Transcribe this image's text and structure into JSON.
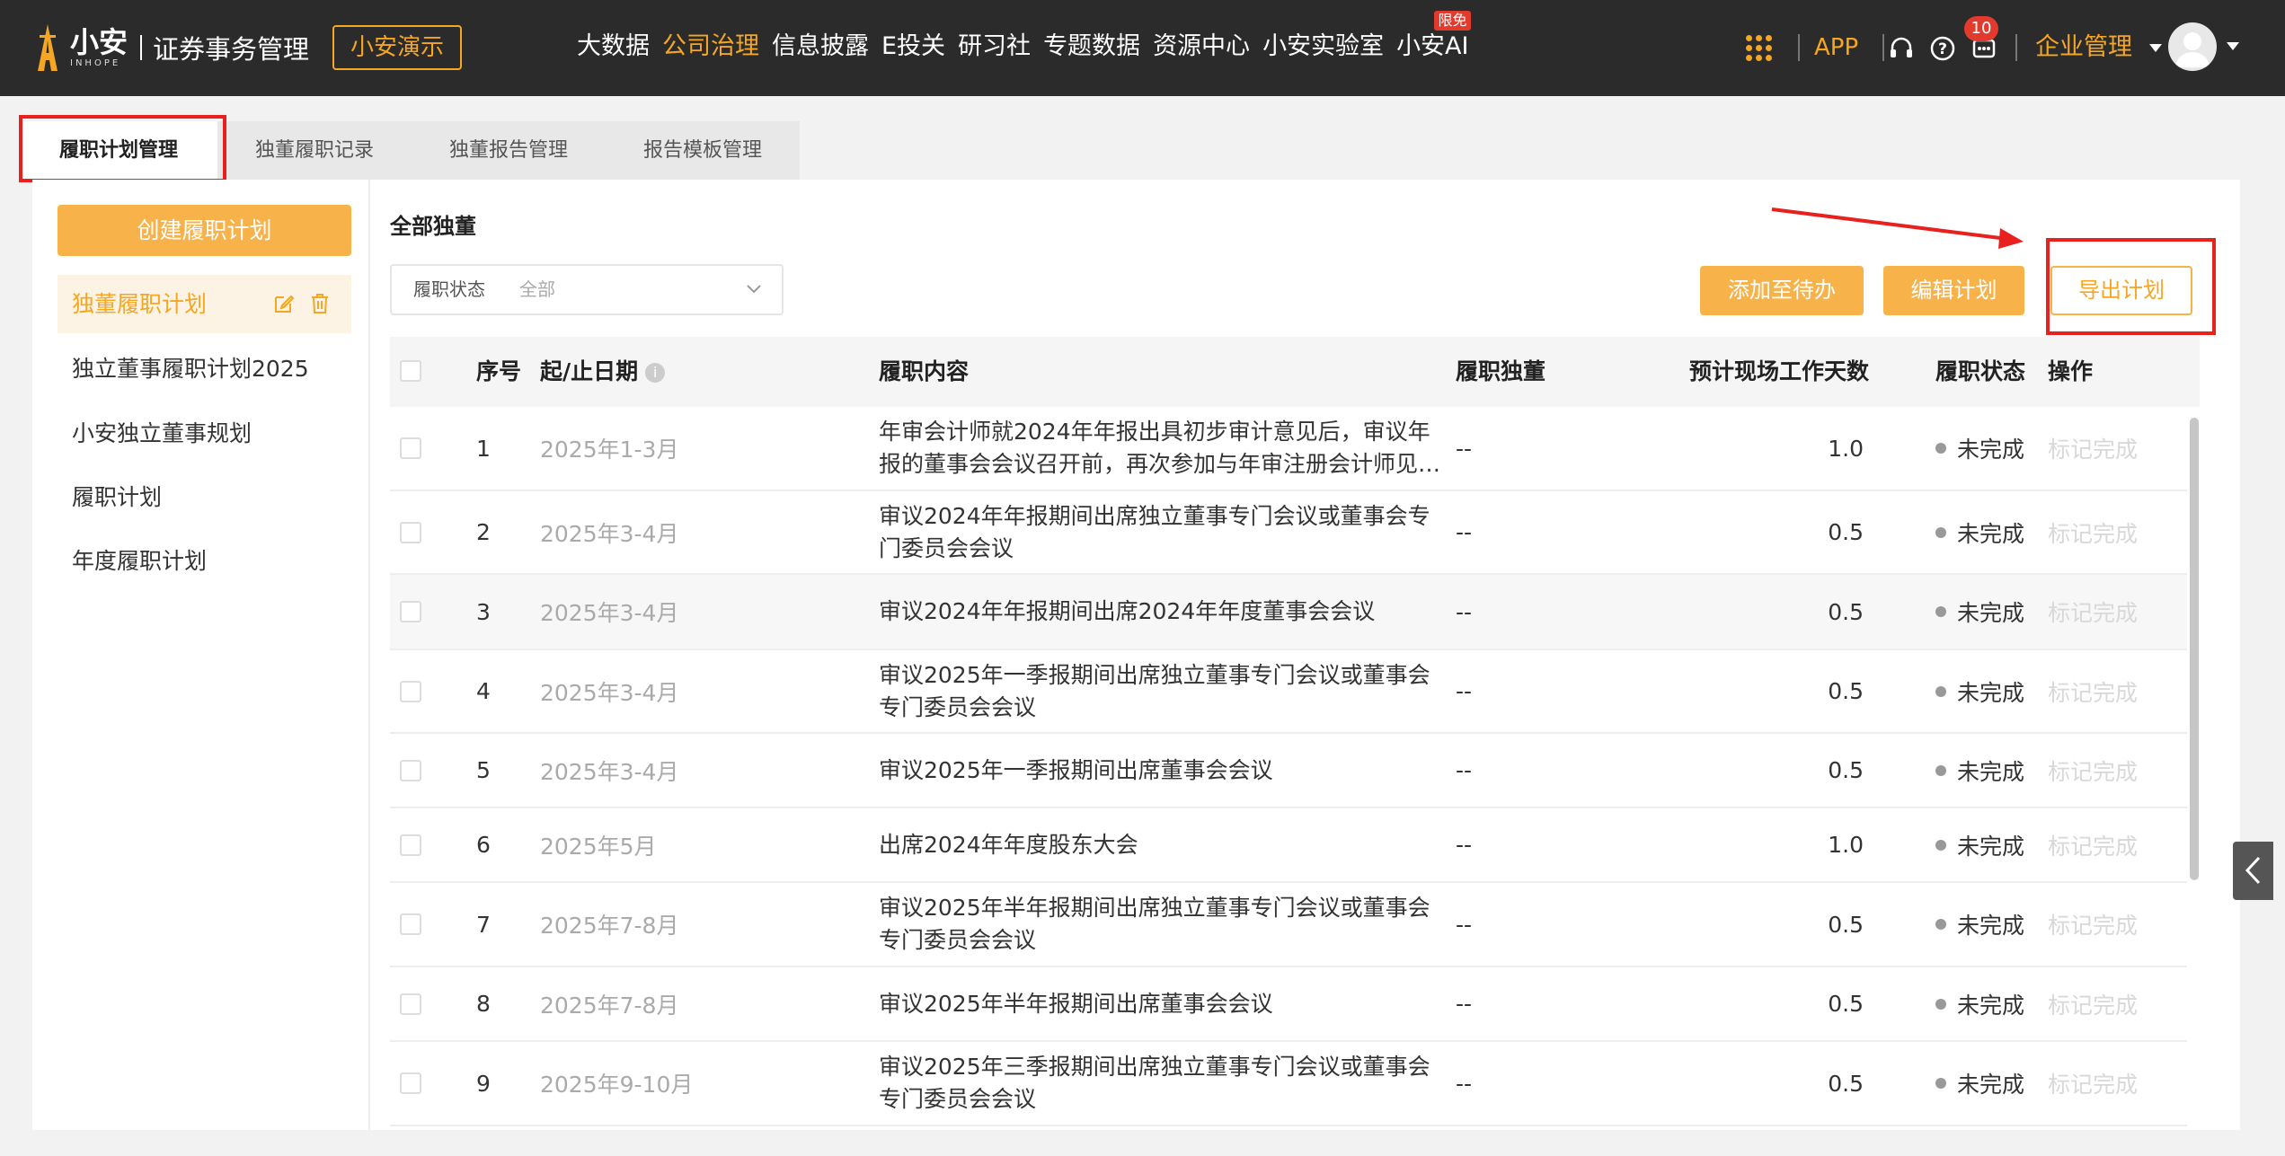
{
  "header": {
    "logo_cn": "小安",
    "logo_en": "INHOPE",
    "app_name": "证券事务管理",
    "demo_button": "小安演示",
    "nav": [
      {
        "label": "大数据",
        "active": false
      },
      {
        "label": "公司治理",
        "active": true
      },
      {
        "label": "信息披露",
        "active": false
      },
      {
        "label": "E投关",
        "active": false
      },
      {
        "label": "研习社",
        "active": false
      },
      {
        "label": "专题数据",
        "active": false
      },
      {
        "label": "资源中心",
        "active": false
      },
      {
        "label": "小安实验室",
        "active": false
      },
      {
        "label": "小安AI",
        "active": false,
        "badge": "限免"
      }
    ],
    "app_link": "APP",
    "notification_count": "10",
    "corp_menu": "企业管理",
    "accent_color": "#f5a623",
    "icons": [
      "apps-grid-icon",
      "headset-icon",
      "help-icon",
      "message-icon",
      "caret-down-icon"
    ]
  },
  "tabs": [
    {
      "label": "履职计划管理",
      "active": true
    },
    {
      "label": "独董履职记录",
      "active": false
    },
    {
      "label": "独董报告管理",
      "active": false
    },
    {
      "label": "报告模板管理",
      "active": false
    }
  ],
  "sidebar": {
    "create_button": "创建履职计划",
    "plans": [
      {
        "label": "独董履职计划",
        "active": true
      },
      {
        "label": "独立董事履职计划2025",
        "active": false
      },
      {
        "label": "小安独立董事规划",
        "active": false
      },
      {
        "label": "履职计划",
        "active": false
      },
      {
        "label": "年度履职计划",
        "active": false
      }
    ]
  },
  "main": {
    "title": "全部独董",
    "filter": {
      "label": "履职状态",
      "value": "全部"
    },
    "buttons": {
      "add_todo": "添加至待办",
      "edit_plan": "编辑计划",
      "export_plan": "导出计划"
    },
    "table": {
      "headers": {
        "index": "序号",
        "date": "起/止日期",
        "content": "履职内容",
        "director": "履职独董",
        "days": "预计现场工作天数",
        "status": "履职状态",
        "op": "操作"
      },
      "rows": [
        {
          "index": "1",
          "date": "2025年1-3月",
          "content": "年审会计师就2024年年报出具初步审计意见后，审议年报的董事会会议召开前，再次参加与年审注册会计师见…",
          "director": "--",
          "days": "1.0",
          "status": "未完成",
          "op": "标记完成"
        },
        {
          "index": "2",
          "date": "2025年3-4月",
          "content": "审议2024年年报期间出席独立董事专门会议或董事会专门委员会会议",
          "director": "--",
          "days": "0.5",
          "status": "未完成",
          "op": "标记完成"
        },
        {
          "index": "3",
          "date": "2025年3-4月",
          "content": "审议2024年年报期间出席2024年年度董事会会议",
          "director": "--",
          "days": "0.5",
          "status": "未完成",
          "op": "标记完成"
        },
        {
          "index": "4",
          "date": "2025年3-4月",
          "content": "审议2025年一季报期间出席独立董事专门会议或董事会专门委员会会议",
          "director": "--",
          "days": "0.5",
          "status": "未完成",
          "op": "标记完成"
        },
        {
          "index": "5",
          "date": "2025年3-4月",
          "content": "审议2025年一季报期间出席董事会会议",
          "director": "--",
          "days": "0.5",
          "status": "未完成",
          "op": "标记完成"
        },
        {
          "index": "6",
          "date": "2025年5月",
          "content": "出席2024年年度股东大会",
          "director": "--",
          "days": "1.0",
          "status": "未完成",
          "op": "标记完成"
        },
        {
          "index": "7",
          "date": "2025年7-8月",
          "content": "审议2025年半年报期间出席独立董事专门会议或董事会专门委员会会议",
          "director": "--",
          "days": "0.5",
          "status": "未完成",
          "op": "标记完成"
        },
        {
          "index": "8",
          "date": "2025年7-8月",
          "content": "审议2025年半年报期间出席董事会会议",
          "director": "--",
          "days": "0.5",
          "status": "未完成",
          "op": "标记完成"
        },
        {
          "index": "9",
          "date": "2025年9-10月",
          "content": "审议2025年三季报期间出席独立董事专门会议或董事会专门委员会会议",
          "director": "--",
          "days": "0.5",
          "status": "未完成",
          "op": "标记完成"
        }
      ]
    }
  }
}
